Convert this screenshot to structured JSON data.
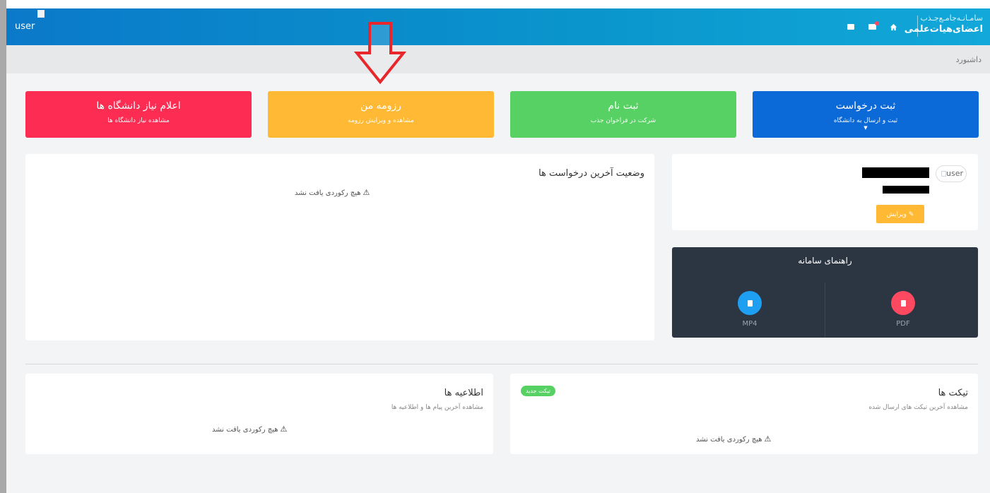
{
  "header": {
    "user_alt": "user",
    "brand_line1": "سامـانـه‌جامـع‌جـذب",
    "brand_line2": "اعضای‌هیات‌علمی",
    "icons": [
      "chat-icon",
      "mail-icon",
      "home-icon"
    ]
  },
  "breadcrumb": "داشبورد",
  "tiles": [
    {
      "title": "ثبت درخواست",
      "subtitle": "ثبت و ارسال به دانشگاه",
      "color": "#0c6ad8"
    },
    {
      "title": "ثبت نام",
      "subtitle": "شرکت در فراخوان جذب",
      "color": "#57d163"
    },
    {
      "title": "رزومه من",
      "subtitle": "مشاهده و ویرایش رزومه",
      "color": "#ffb935"
    },
    {
      "title": "اعلام نیاز دانشگاه ها",
      "subtitle": "مشاهده نیاز دانشگاه ها",
      "color": "#fc2c52"
    }
  ],
  "status_card": {
    "title": "وضعیت آخرین درخواست ها",
    "empty": "هیچ رکوردی یافت نشد"
  },
  "profile_card": {
    "avatar_alt": "user",
    "edit_label": "ویرایش"
  },
  "guide_card": {
    "title": "راهنمای سامانه",
    "items": [
      "PDF",
      "MP4"
    ]
  },
  "tickets_card": {
    "title": "تیکت ها",
    "subtitle": "مشاهده آخرین تیکت های ارسال شده",
    "new_badge": "تیکت جدید",
    "empty": "هیچ رکوردی یافت نشد"
  },
  "news_card": {
    "title": "اطلاعیه ها",
    "subtitle": "مشاهده آخرین پیام ها و اطلاعیه ها",
    "empty": "هیچ رکوردی یافت نشد"
  },
  "colors": {
    "header": "#0a96cc",
    "arrow": "#e8262c",
    "guide_bg": "#2c3643"
  }
}
